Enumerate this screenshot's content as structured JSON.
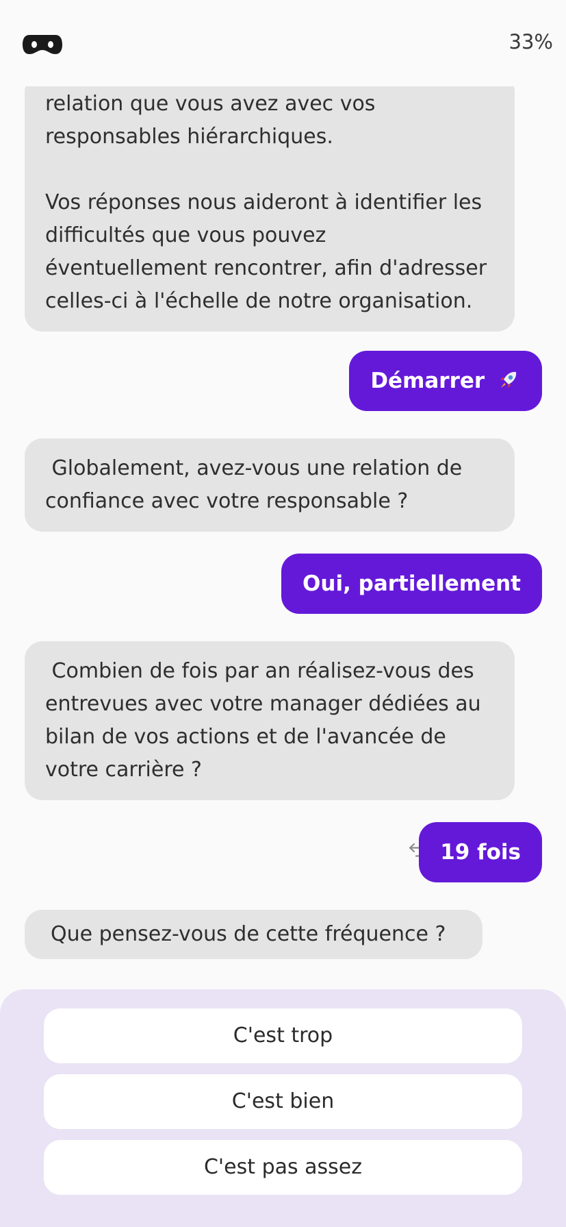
{
  "header": {
    "logo_icon": "mask-icon",
    "progress": "33%"
  },
  "messages": [
    {
      "role": "bot",
      "paragraphs": [
        "relation que vous avez avec vos responsables hiérarchiques.",
        "Vos réponses nous aideront à identifier les difficultés que vous pouvez éventuellement rencontrer, afin d'adresser celles-ci à l'échelle de notre organisation."
      ]
    },
    {
      "role": "user",
      "text": "Démarrer",
      "icon": "rocket-icon"
    },
    {
      "role": "bot",
      "text": " Globalement, avez-vous une relation de confiance avec votre responsable ?"
    },
    {
      "role": "user",
      "text": "Oui, partiellement"
    },
    {
      "role": "bot",
      "text": " Combien de fois par an réalisez-vous des entrevues avec votre manager dédiées au bilan de vos actions et de l'avancée de votre carrière ?"
    },
    {
      "role": "user",
      "text": "19 fois",
      "icon": "undo-icon"
    },
    {
      "role": "bot",
      "text": "Que pensez-vous de cette fréquence ?"
    }
  ],
  "choices": [
    "C'est trop",
    "C'est bien",
    "C'est pas assez"
  ],
  "colors": {
    "accent": "#6419d9",
    "bot_bubble": "#e4e4e4",
    "answers_panel": "#e9e3f5",
    "background": "#fafafa"
  }
}
